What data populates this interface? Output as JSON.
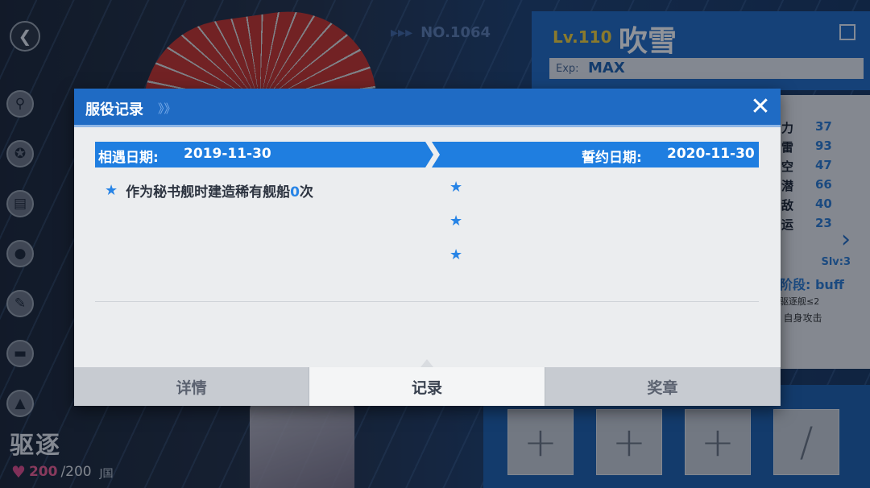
{
  "ship": {
    "number": "NO.1064",
    "level": "Lv.110",
    "name": "吹雪",
    "exp_label": "Exp:",
    "exp_value": "MAX",
    "type": "驱逐",
    "hp_current": "200",
    "hp_max": "/200",
    "nation": "J国"
  },
  "stats": [
    {
      "label": "力",
      "value": "37"
    },
    {
      "label": "雷",
      "value": "93"
    },
    {
      "label": "空",
      "value": "47"
    },
    {
      "label": "潜",
      "value": "66"
    },
    {
      "label": "敌",
      "value": "40"
    },
    {
      "label": "运",
      "value": "23"
    }
  ],
  "skill": {
    "level": "Slv:3",
    "phase": "阶段: buff",
    "condition": "驱逐舰≤2",
    "effect": ") 自身攻击"
  },
  "modal": {
    "title": "服役记录",
    "title_arrows": "》》",
    "close": "✕",
    "meet_date_label": "相遇日期:",
    "meet_date": "2019-11-30",
    "oath_date_label": "誓约日期:",
    "oath_date": "2020-11-30",
    "record_text": "作为秘书舰时建造稀有舰船",
    "record_count": "0",
    "record_unit": "次",
    "tabs": [
      "详情",
      "记录",
      "奖章"
    ],
    "active_tab": "记录"
  },
  "icons": {
    "back": "back-icon",
    "edit": "edit-icon",
    "star": "★",
    "next": "chevron-right-icon"
  },
  "colors": {
    "accent_blue": "#1f6bc4",
    "level_yellow": "#f5d23b",
    "heart_pink": "#f15e92"
  }
}
